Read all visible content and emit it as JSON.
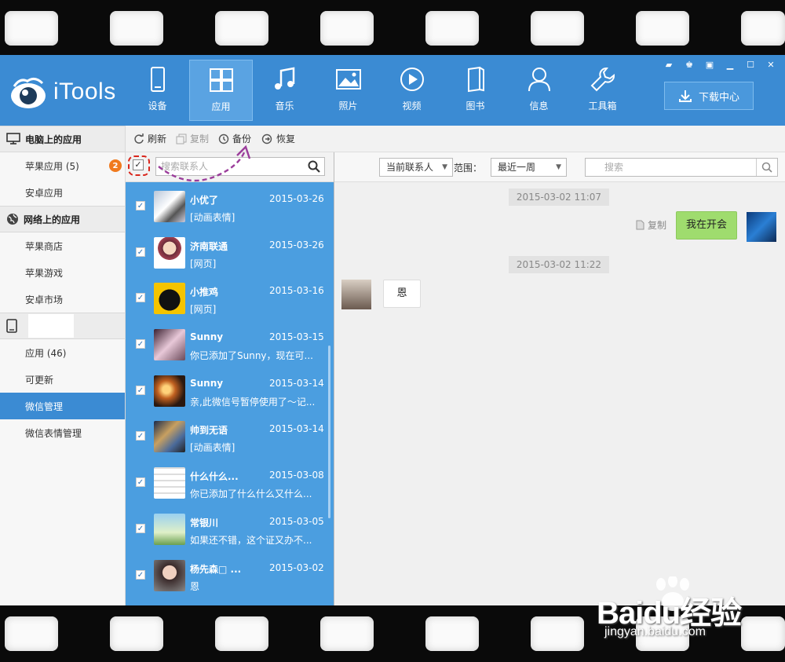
{
  "app": {
    "logo_text": "iTools",
    "nav": [
      {
        "label": "设备",
        "icon": "device-icon"
      },
      {
        "label": "应用",
        "icon": "apps-icon",
        "active": true
      },
      {
        "label": "音乐",
        "icon": "music-icon"
      },
      {
        "label": "照片",
        "icon": "photo-icon"
      },
      {
        "label": "视频",
        "icon": "video-icon"
      },
      {
        "label": "图书",
        "icon": "book-icon"
      },
      {
        "label": "信息",
        "icon": "user-icon"
      },
      {
        "label": "工具箱",
        "icon": "wrench-icon"
      }
    ],
    "download_label": "下载中心"
  },
  "sidebar": {
    "section_pc": "电脑上的应用",
    "pc_items": [
      {
        "label": "苹果应用 (5)",
        "badge": "2"
      },
      {
        "label": "安卓应用"
      }
    ],
    "section_web": "网络上的应用",
    "web_items": [
      "苹果商店",
      "苹果游戏",
      "安卓市场"
    ],
    "device_items": [
      "应用 (46)",
      "可更新",
      "微信管理",
      "微信表情管理"
    ],
    "active_item": "微信管理"
  },
  "toolbar": {
    "refresh": "刷新",
    "copy": "复制",
    "backup": "备份",
    "restore": "恢复"
  },
  "contacts": {
    "search_placeholder": "搜索联系人",
    "rows": [
      {
        "name": "小优了",
        "date": "2015-03-26",
        "msg": "[动画表情]"
      },
      {
        "name": "济南联通",
        "date": "2015-03-26",
        "msg": "[网页]"
      },
      {
        "name": "小推鸡",
        "date": "2015-03-16",
        "msg": "[网页]"
      },
      {
        "name": "Sunny",
        "date": "2015-03-15",
        "msg": "你已添加了Sunny，现在可..."
      },
      {
        "name": "Sunny",
        "date": "2015-03-14",
        "msg": "亲,此微信号暂停使用了～记..."
      },
      {
        "name": "帅到无语",
        "date": "2015-03-14",
        "msg": "[动画表情]"
      },
      {
        "name": "什么什么...",
        "date": "2015-03-08",
        "msg": "你已添加了什么什么又什么..."
      },
      {
        "name": "常银川",
        "date": "2015-03-05",
        "msg": "如果还不错，这个证又办不..."
      },
      {
        "name": "杨先森□ ...",
        "date": "2015-03-02",
        "msg": "恩"
      }
    ]
  },
  "chat": {
    "contact_filter": "当前联系人",
    "range_label": "范围：",
    "range_value": "最近一周",
    "search_placeholder": "搜索",
    "ts1": "2015-03-02 11:07",
    "copy_label": "复制",
    "msg_out": "我在开会",
    "ts2": "2015-03-02 11:22",
    "msg_in": "恩"
  },
  "watermark": {
    "brand": "Baidu经验",
    "url": "jingyan.baidu.com"
  },
  "colors": {
    "header": "#3b8bd3",
    "contacts_bg": "#4b9ee0",
    "accent_badge": "#f07a1e",
    "bubble_out": "#9fdc6e"
  }
}
